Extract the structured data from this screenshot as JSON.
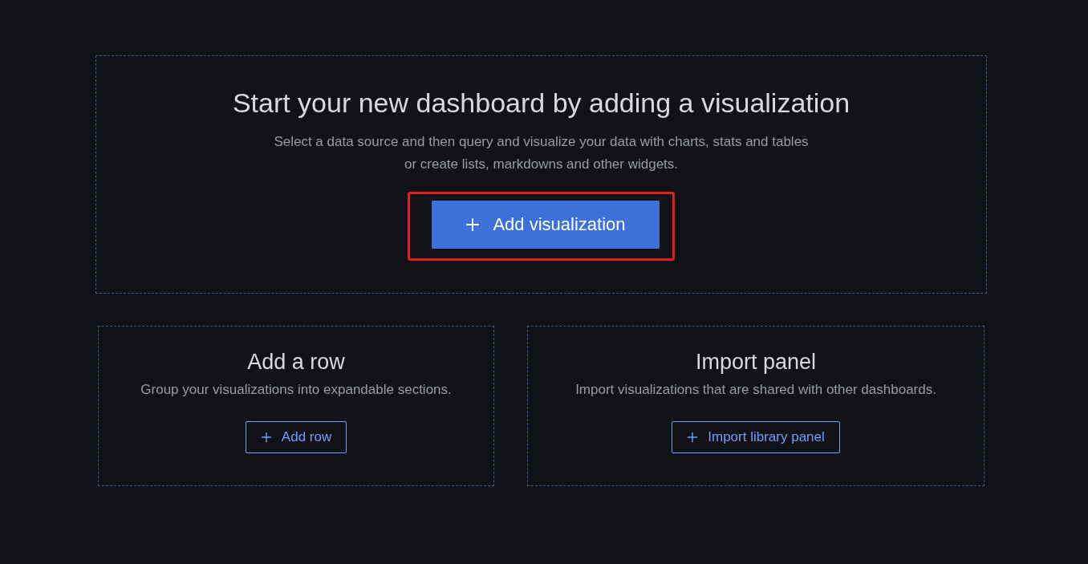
{
  "main": {
    "title": "Start your new dashboard by adding a visualization",
    "description_lines": [
      "Select a data source and then query and visualize your data with charts, stats and tables",
      "or create lists, markdowns and other widgets."
    ],
    "button": {
      "label": "Add visualization",
      "highlighted": true
    }
  },
  "cards": [
    {
      "title": "Add a row",
      "description": "Group your visualizations into expandable sections.",
      "button": {
        "label": "Add row"
      }
    },
    {
      "title": "Import panel",
      "description": "Import visualizations that are shared with other dashboards.",
      "button": {
        "label": "Import library panel"
      }
    }
  ]
}
